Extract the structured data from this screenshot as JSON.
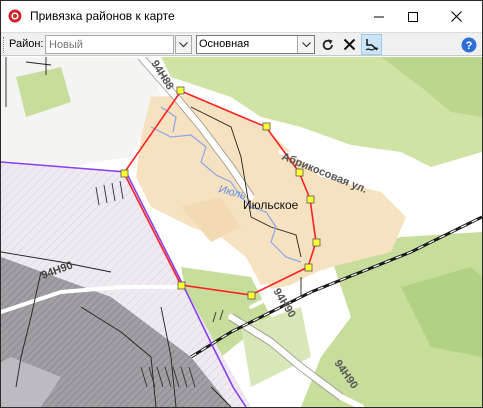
{
  "window": {
    "title": "Привязка районов к карте"
  },
  "toolbar": {
    "region_label": "Район:",
    "region_placeholder": "Новый",
    "layer_value": "Основная"
  },
  "icons": {
    "app": "app-record-icon",
    "minimize": "minimize-icon",
    "maximize": "maximize-icon",
    "close": "close-icon",
    "refresh": "refresh-icon",
    "delete": "delete-x-icon",
    "snap": "snap-tool-icon",
    "help": "help-icon"
  },
  "map": {
    "labels": {
      "road_top": "94Н88",
      "street": "Абрикосовая ул.",
      "river": "Июль",
      "village": "Июльское",
      "road_left": "94Н90",
      "road_mid": "94Н90",
      "road_bottom": "94Н90"
    },
    "colors": {
      "boundary": "#ff2020",
      "vertex_fill": "#ffff33",
      "settlement": "#f7e3c2",
      "forest": "#bcd68f",
      "hatched_zone": "#ece6ee",
      "district_border": "#8a3ff0",
      "river": "#8ca7e8",
      "railway": "#1a1a1a"
    }
  }
}
